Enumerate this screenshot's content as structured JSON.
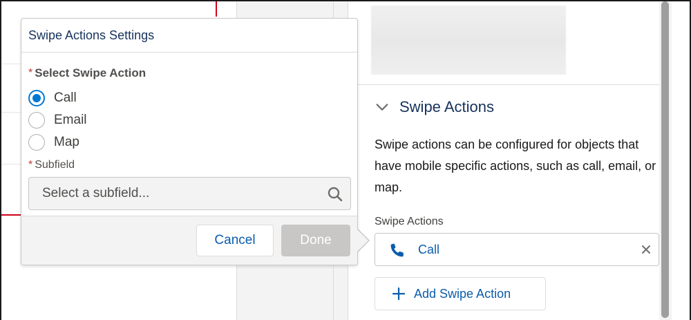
{
  "popover": {
    "title": "Swipe Actions Settings",
    "select_label": "Select Swipe Action",
    "required_marker": "*",
    "options": [
      "Call",
      "Email",
      "Map"
    ],
    "selected_option": "Call",
    "subfield_label": "Subfield",
    "subfield_placeholder": "Select a subfield...",
    "cancel_label": "Cancel",
    "done_label": "Done"
  },
  "panel": {
    "section_title": "Swipe Actions",
    "section_description": "Swipe actions can be configured for objects that have mobile specific actions, such as call, email, or map.",
    "field_label": "Swipe Actions",
    "action_item_label": "Call",
    "add_button_label": "Add Swipe Action"
  },
  "colors": {
    "brand_blue": "#0176d3",
    "link_blue": "#0b5cab",
    "title_navy": "#16325c",
    "required_red": "#c23934",
    "disabled_gray": "#c9c7c5"
  },
  "icons": [
    "chevron-down-icon",
    "phone-icon",
    "close-icon",
    "plus-icon",
    "search-icon"
  ]
}
